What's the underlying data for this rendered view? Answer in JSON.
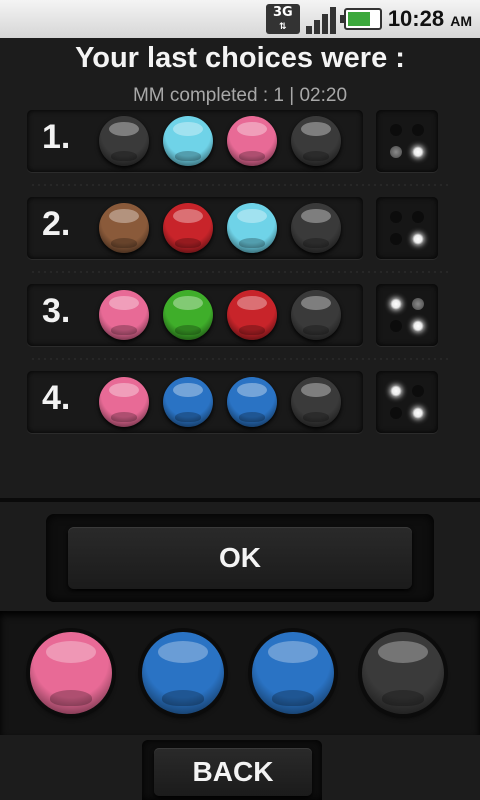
{
  "status_bar": {
    "network": "3G",
    "time": "10:28",
    "ampm": "AM",
    "icons": [
      "3g-data-icon",
      "signal-icon",
      "battery-charging-icon"
    ]
  },
  "header": {
    "title": "Your last choices were :",
    "subtitle": "MM completed : 1 | 02:20"
  },
  "colors": {
    "black": "#3a3a3a",
    "cyan": "#6fd3e8",
    "pink": "#e86a96",
    "brown": "#8a5a3a",
    "red": "#c8242a",
    "green": "#3fae2a",
    "blue": "#2a73c4"
  },
  "choices": [
    {
      "number": "1.",
      "balls": [
        "black",
        "cyan",
        "pink",
        "black"
      ],
      "pegs": [
        "empty",
        "empty",
        "grey",
        "white"
      ]
    },
    {
      "number": "2.",
      "balls": [
        "brown",
        "red",
        "cyan",
        "black"
      ],
      "pegs": [
        "empty",
        "empty",
        "empty",
        "white"
      ]
    },
    {
      "number": "3.",
      "balls": [
        "pink",
        "green",
        "red",
        "black"
      ],
      "pegs": [
        "white",
        "grey",
        "empty",
        "white"
      ]
    },
    {
      "number": "4.",
      "balls": [
        "pink",
        "blue",
        "blue",
        "black"
      ],
      "pegs": [
        "white",
        "empty",
        "empty",
        "white"
      ]
    }
  ],
  "ok_label": "OK",
  "selection": [
    "pink",
    "blue",
    "blue",
    "black"
  ],
  "back_label": "BACK"
}
